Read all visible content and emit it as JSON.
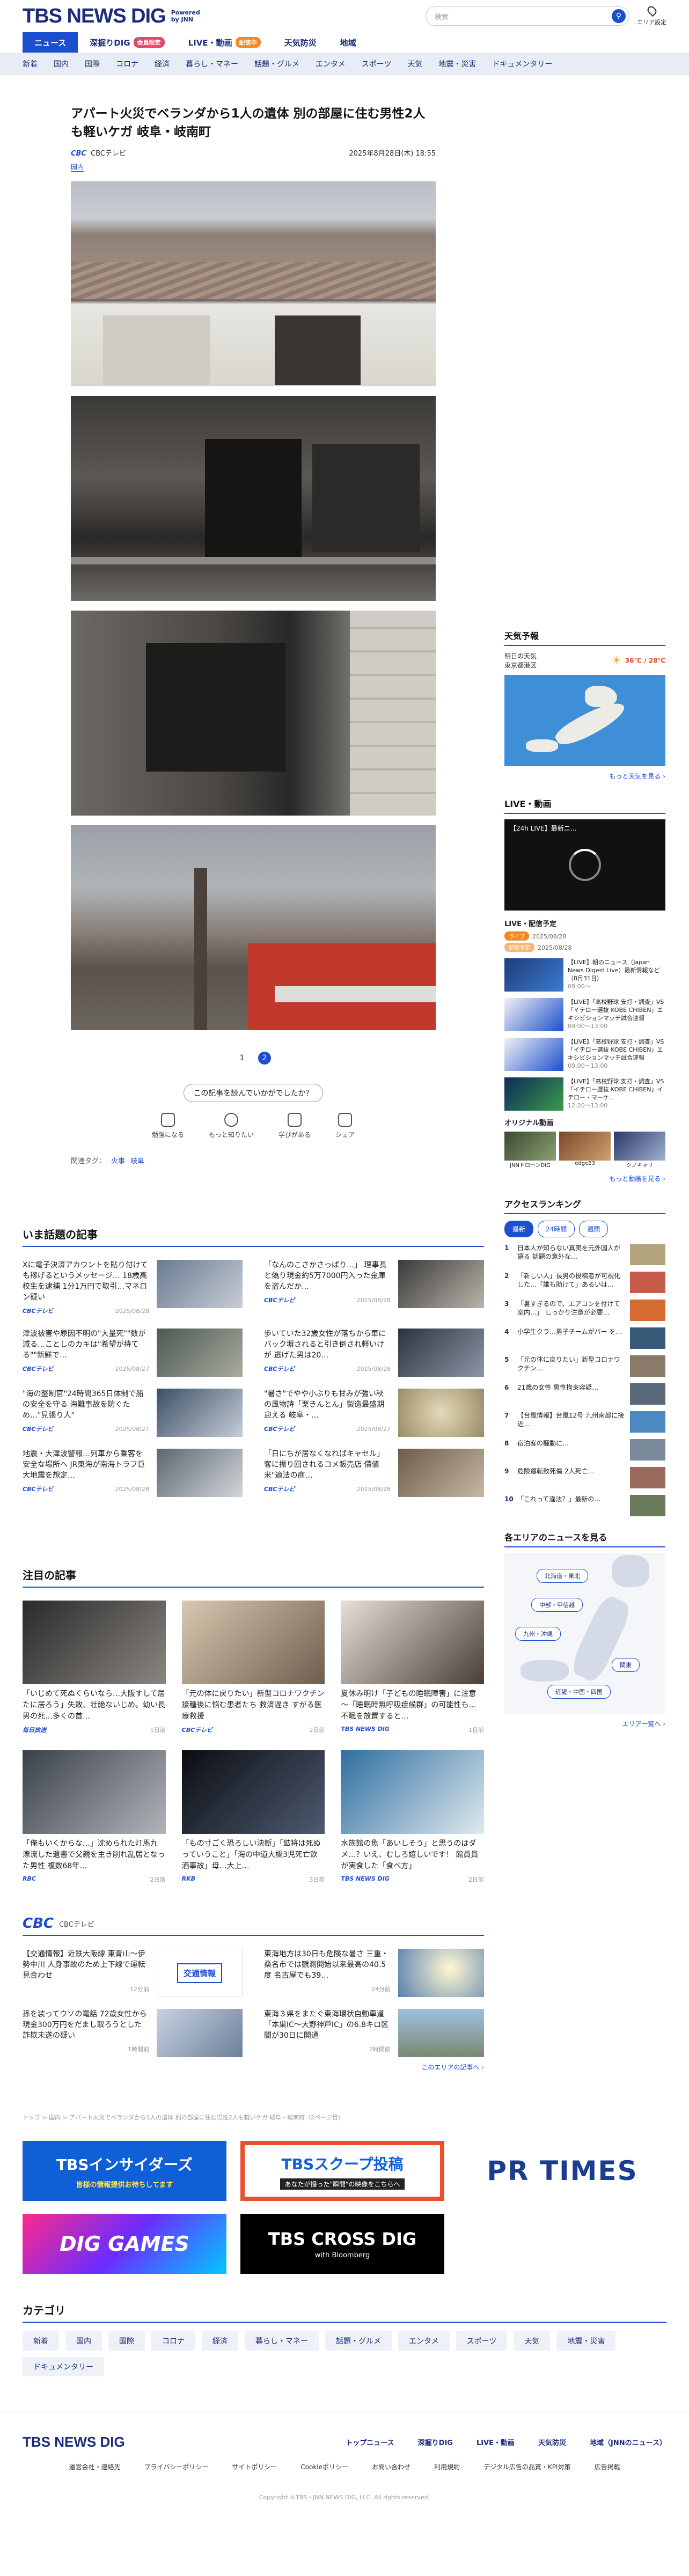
{
  "header": {
    "logo": "TBS NEWS DIG",
    "powered": "Powered by JNN",
    "search_placeholder": "検索",
    "area_label": "エリア設定"
  },
  "nav": {
    "tabs": [
      {
        "label": "ニュース",
        "active": true,
        "badge": ""
      },
      {
        "label": "深掘りDIG",
        "active": false,
        "badge": "会員限定"
      },
      {
        "label": "LIVE・動画",
        "active": false,
        "badge": "配信中"
      },
      {
        "label": "天気防災",
        "active": false,
        "badge": ""
      },
      {
        "label": "地域",
        "active": false,
        "badge": ""
      }
    ],
    "categories": [
      "新着",
      "国内",
      "国際",
      "コロナ",
      "経済",
      "暮らし・マネー",
      "話題・グルメ",
      "エンタメ",
      "スポーツ",
      "天気",
      "地震・災害",
      "ドキュメンタリー"
    ]
  },
  "article": {
    "title": "アパート火災でベランダから1人の遺体 別の部屋に住む男性2人も軽いケガ 岐阜・岐南町",
    "source": "CBCテレビ",
    "date": "2025年8月28日(木) 18:55",
    "tag": "国内",
    "photo_count": 4,
    "pages": [
      "1",
      "2"
    ],
    "current_page": "2",
    "feedback_q": "この記事を読んでいかがでしたか？",
    "reactions": [
      "勉強になる",
      "もっと知りたい",
      "学びがある",
      "シェア"
    ],
    "related_label": "関連タグ：",
    "related_tags": [
      "火事",
      "岐阜"
    ]
  },
  "trending": {
    "heading": "いま話題の記事",
    "items": [
      {
        "title": "Xに電子決済アカウントを貼り付けても稼げるというメッセージ… 18歳高校生を逮捕 1分1万円で取引…マネロン疑い",
        "src": "CBCテレビ",
        "time": "2025/08/28"
      },
      {
        "title": "「なんのこさかさっぱり…」 理事長と偽り現金約5万7000円入った金庫を盗んだか…",
        "src": "CBCテレビ",
        "time": "2025/08/28"
      },
      {
        "title": "津波被害や原因不明の\"大量死\"\"数が減る…ことしのカキは\"希望が持てる\"\"新鮮で…",
        "src": "CBCテレビ",
        "time": "2025/08/27"
      },
      {
        "title": "歩いていた32歳女性が落ちから車にバック塀されると引き倒され軽いけが 逃げた男は20…",
        "src": "CBCテレビ",
        "time": "2025/08/28"
      },
      {
        "title": "\"海の整制官\"24時間365日体制で船の安全を守る 海難事故を防ぐため…\"見張り人\"",
        "src": "CBCテレビ",
        "time": "2025/08/27"
      },
      {
        "title": "\"暑さ\"でやや小ぶりも甘みが強い秋の風物詩「栗きんとん」製造最盛期迎える 岐阜・…",
        "src": "CBCテレビ",
        "time": "2025/08/27"
      },
      {
        "title": "地震・大津波警報…列車から乗客を安全な場所へ JR東海が南海トラフ巨大地震を想定…",
        "src": "CBCテレビ",
        "time": "2025/08/28"
      },
      {
        "title": "「日にちが居なくなればキャセル」客に振り回されるコメ販売店 價値米\"適法の商…",
        "src": "CBCテレビ",
        "time": "2025/08/28"
      }
    ]
  },
  "featured": {
    "heading": "注目の記事",
    "items": [
      {
        "title": "「いじめて死ぬくらいなら…大阪すして居たに居ろう」失敗、壮絶ないじめ。幼い長男の死…多くの首…",
        "src": "毎日放送",
        "time": "1日前"
      },
      {
        "title": "「元の体に戻りたい」新型コロナワクチン接種後に悩む患者たち 救済遅き すがる医療救援",
        "src": "CBCテレビ",
        "time": "2日前"
      },
      {
        "title": "夏休み明け「子どもの睡眠障害」に注意 ～「睡眠時無呼吸症候群」の可能性も… 不眠を放置すると…",
        "src": "TBS NEWS DIG",
        "time": "1日前"
      },
      {
        "title": "「俺もいくからな…」沈められた灯馬九 漂流した遺書で父親を主き削れ乱居となった男性 複数68年…",
        "src": "RBC",
        "time": "2日前"
      },
      {
        "title": "「もの寸ごく恐ろしい決断」「鉱将は死ぬっていうこと」「海の中道大橋3児死亡飲酒事故」母…大上…",
        "src": "RKB",
        "time": "3日前"
      },
      {
        "title": "水族館の魚「あいしそう」と思うのはダメ…？いえ、むしろ嬉しいです！ 館員員が実食した「食べ方」",
        "src": "TBS NEWS DIG",
        "time": "2日前"
      }
    ]
  },
  "cbc": {
    "label": "CBCテレビ",
    "items": [
      {
        "title": "【交通情報】近鉄大阪線 東青山〜伊勢中川 人身事故のため上下線で運転見合わせ",
        "time": "12分前",
        "thumb_text": "交通情報"
      },
      {
        "title": "東海地方は30日も危険な暑さ 三重・桑名市では観測開始以来最高の40.5度 名古屋でも39…",
        "time": "24分前",
        "thumb_text": ""
      },
      {
        "title": "孫を装ってウソの電話 72歳女性から現金300万円をだまし取ろうとした詐欺未遂の疑い",
        "time": "1時間前",
        "thumb_text": ""
      },
      {
        "title": "東海３県をまたぐ東海環状自動車道「本巣IC〜大野神戸IC」の6.8キロ区間が30日に開通",
        "time": "2時間前",
        "thumb_text": ""
      }
    ],
    "more": "このエリアの記事へ ›"
  },
  "breadcrumb": "トップ > 国内 > アパート火災でベランダから1人の遺体 別の部屋に住む男性2人も軽いケガ 岐阜・岐南町（2ページ目）",
  "banners": [
    {
      "title": "TBSインサイダーズ",
      "sub": "皆様の情報提供お待ちしてます"
    },
    {
      "title": "TBSスクープ投稿",
      "sub": "あなたが撮った\"瞬間\"の映像をこちらへ"
    },
    {
      "title": "PR TIMES",
      "sub": ""
    },
    {
      "title": "DIG GAMES",
      "sub": ""
    },
    {
      "title": "TBS CROSS DIG",
      "sub": "with Bloomberg"
    }
  ],
  "category_section": {
    "heading": "カテゴリ",
    "items": [
      "新着",
      "国内",
      "国際",
      "コロナ",
      "経済",
      "暮らし・マネー",
      "話題・グルメ",
      "エンタメ",
      "スポーツ",
      "天気",
      "地震・災害",
      "ドキュメンタリー"
    ]
  },
  "weather": {
    "heading": "天気予報",
    "day": "明日の天気",
    "city": "東京都港区",
    "temps": "36℃ / 28℃",
    "more": "もっと天気を見る ›"
  },
  "live": {
    "heading": "LIVE・動画",
    "video_title": "【24h LIVE】最新ニ…",
    "schedule_heading": "LIVE・配信予定",
    "badges": [
      "ライブ",
      "配信予定"
    ],
    "schedule_dates": [
      "2025/08/28",
      "2025/08/28"
    ],
    "schedule": [
      {
        "title": "【LIVE】朝のニュース（Japan News Digest Live）最新情報など（8月31日）",
        "time": "08:00～"
      },
      {
        "title": "【LIVE】「高校野球 安打・調査」VS「イテロー選抜 KOBE CHIBEN」エキシビションマッチ試合速報",
        "time": "09:00～13:00"
      },
      {
        "title": "【LIVE】「高校野球 安打・調査」VS「イテロー選抜 KOBE CHIBEN」エキシビションマッチ試合速報",
        "time": "09:00～13:00"
      },
      {
        "title": "【LIVE】「高校野球 安打・調査」VS「イテロー選抜 KOBE CHIBEN」イテロー・マーケ…",
        "time": "12:20～13:00"
      }
    ],
    "original_heading": "オリジナル動画",
    "originals": [
      "JNNドローンDIG",
      "edge23",
      "シノキャリ"
    ],
    "more": "もっと動画を見る ›"
  },
  "ranking": {
    "heading": "アクセスランキング",
    "tabs": [
      "最新",
      "24時間",
      "週間"
    ],
    "items": [
      "日本人が知らない真実を元外国人が語る 話題の意外な…",
      "「新しい人」長男の投稿者が可視化した…「誰も助けて」あるいは…",
      "「暑すぎるので、エアコンを付けて室内…」 しっかり注意が必要…",
      "小学生クラ…男子チームがバー を…",
      "「元の体に戻りたい」新型コロナワクチン…",
      "21歳の女性 男性拘束容疑…",
      "【台風情報】台風12号 九州南部に接近…",
      "宿泊客の騒動に…",
      "危険運転致死傷 2人死亡…",
      "「これって違法？」最新の…"
    ]
  },
  "areas": {
    "heading": "各エリアのニュースを見る",
    "buttons": [
      "北海道・東北",
      "中部・甲信越",
      "九州・沖縄",
      "関東",
      "近畿・中国・四国"
    ],
    "more": "エリア一覧へ ›"
  },
  "footer": {
    "links1": [
      "トップニュース",
      "深掘りDIG",
      "LIVE・動画",
      "天気防災",
      "地域（JNNのニュース）"
    ],
    "links2": [
      "運営会社・連絡先",
      "プライバシーポリシー",
      "サイトポリシー",
      "Cookieポリシー",
      "お問い合わせ",
      "利用規約",
      "デジタル広告の品質・KPI対策",
      "広告掲載"
    ],
    "copyright": "Copyright ©TBS・JNN NEWS DIG, LLC. All rights reserved."
  },
  "colors": {
    "brand": "#1b2c7a",
    "accent": "#1b4fcf",
    "live": "#f08a24"
  }
}
